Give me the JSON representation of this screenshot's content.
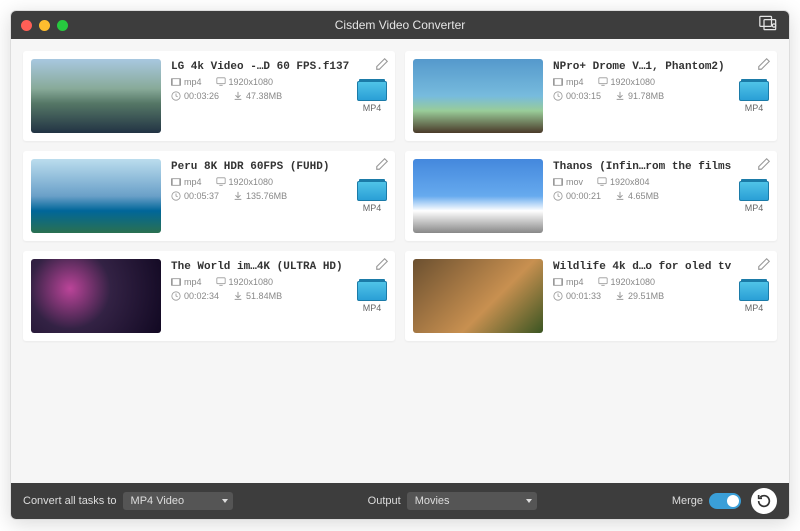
{
  "window": {
    "title": "Cisdem Video Converter"
  },
  "videos": [
    {
      "title": "LG 4k Video -…D 60 FPS.f137",
      "format": "mp4",
      "resolution": "1920x1080",
      "duration": "00:03:26",
      "size": "47.38MB",
      "output": "MP4"
    },
    {
      "title": "NPro+ Drome V…1, Phantom2)",
      "format": "mp4",
      "resolution": "1920x1080",
      "duration": "00:03:15",
      "size": "91.78MB",
      "output": "MP4"
    },
    {
      "title": "Peru 8K HDR 60FPS (FUHD)",
      "format": "mp4",
      "resolution": "1920x1080",
      "duration": "00:05:37",
      "size": "135.76MB",
      "output": "MP4"
    },
    {
      "title": "Thanos (Infin…rom the films",
      "format": "mov",
      "resolution": "1920x804",
      "duration": "00:00:21",
      "size": "4.65MB",
      "output": "MP4"
    },
    {
      "title": "The World im…4K (ULTRA HD)",
      "format": "mp4",
      "resolution": "1920x1080",
      "duration": "00:02:34",
      "size": "51.84MB",
      "output": "MP4"
    },
    {
      "title": "Wildlife 4k d…o for oled tv",
      "format": "mp4",
      "resolution": "1920x1080",
      "duration": "00:01:33",
      "size": "29.51MB",
      "output": "MP4"
    }
  ],
  "bottombar": {
    "convert_label": "Convert all tasks to",
    "convert_value": "MP4 Video",
    "output_label": "Output",
    "output_value": "Movies",
    "merge_label": "Merge"
  }
}
